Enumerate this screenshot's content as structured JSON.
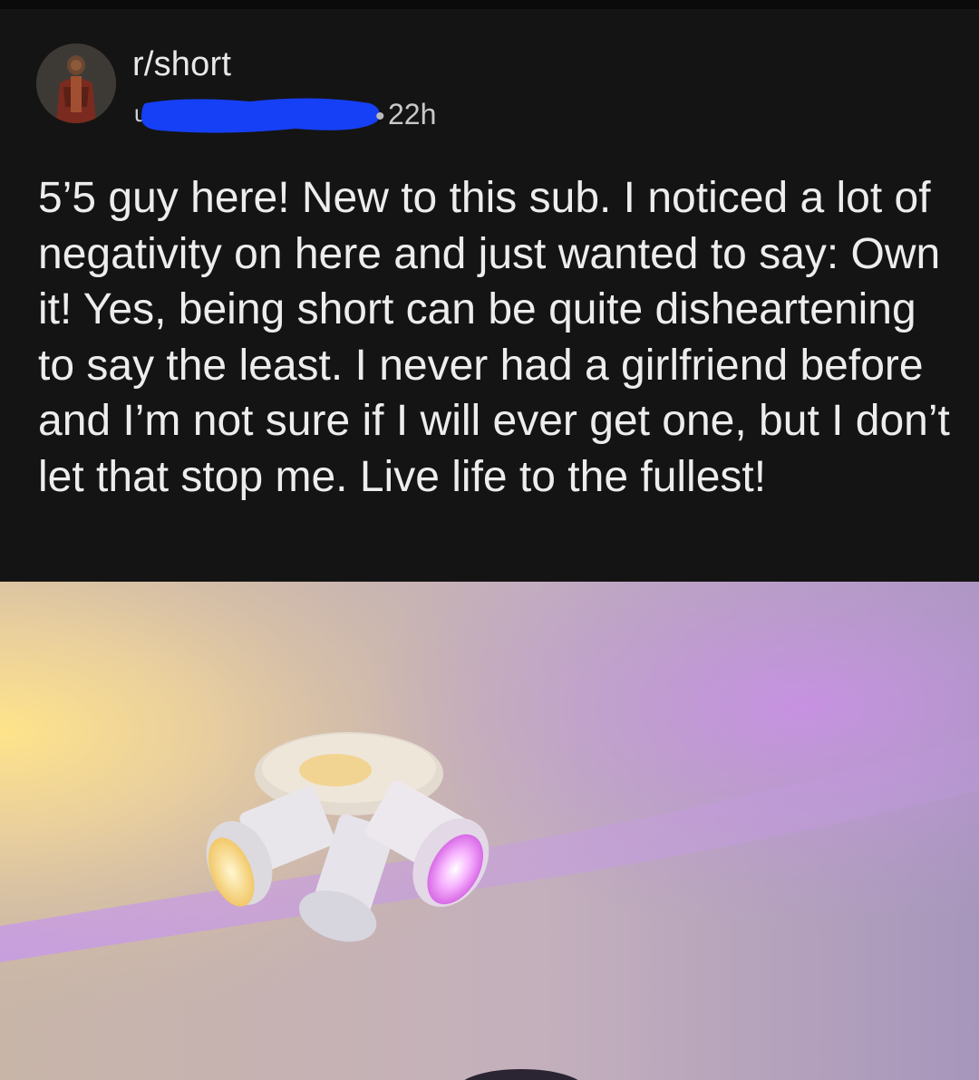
{
  "post": {
    "subreddit": "r/short",
    "username_visible_char": "u",
    "timestamp": "22h",
    "dot": "•",
    "body": "5’5 guy here! New to this sub. I noticed a lot of negativity on here and just wanted to say: Own it! Yes, being short can be quite disheartening to say the least. I never had a girlfriend before and I’m not sure if I will ever get one, but I don’t let that stop me. Live life to the fullest!"
  },
  "colors": {
    "background": "#141414",
    "redaction": "#1640f5",
    "ceiling_purple": "#b88ad6",
    "lamp_glow": "#f7d77a"
  },
  "icons": {
    "avatar": "user-avatar-icon"
  }
}
